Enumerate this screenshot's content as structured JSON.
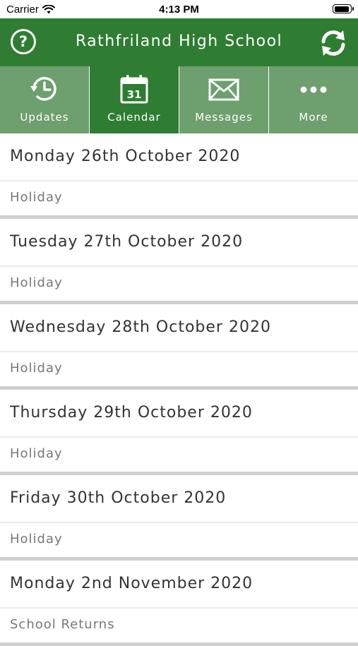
{
  "status_bar": {
    "carrier": "Carrier",
    "time": "4:13 PM"
  },
  "header": {
    "title": "Rathfriland High School",
    "help_label": "?"
  },
  "tabs": [
    {
      "label": "Updates",
      "icon": "clock-refresh-icon"
    },
    {
      "label": "Calendar",
      "icon": "calendar-icon",
      "date": "31"
    },
    {
      "label": "Messages",
      "icon": "envelope-icon"
    },
    {
      "label": "More",
      "icon": "more-dots-icon"
    }
  ],
  "days": [
    {
      "date": "Monday 26th October 2020",
      "events": [
        "Holiday"
      ]
    },
    {
      "date": "Tuesday 27th October 2020",
      "events": [
        "Holiday"
      ]
    },
    {
      "date": "Wednesday 28th October 2020",
      "events": [
        "Holiday"
      ]
    },
    {
      "date": "Thursday 29th October 2020",
      "events": [
        "Holiday"
      ]
    },
    {
      "date": "Friday 30th October 2020",
      "events": [
        "Holiday"
      ]
    },
    {
      "date": "Monday 2nd November 2020",
      "events": [
        "School Returns"
      ]
    }
  ],
  "colors": {
    "primary": "#2e7d32",
    "tab_inactive": "#6e9f6e",
    "divider": "#cfcfcf"
  }
}
